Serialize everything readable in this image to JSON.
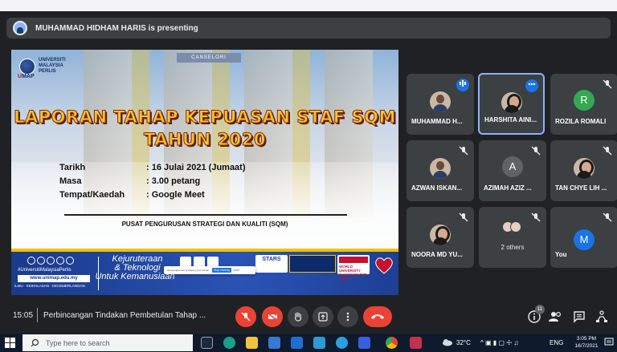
{
  "presenting": {
    "text": "MUHAMMAD HIDHAM HARIS is presenting"
  },
  "slide": {
    "logo_line1": "UNIVERSITI",
    "logo_line2": "MALAYSIA",
    "logo_line3": "PERLIS",
    "logo_abbr_prefix": "U",
    "logo_abbr": "MAP",
    "sign": "CANSELORI",
    "title_line1": "LAPORAN TAHAP KEPUASAN STAF SQM",
    "title_line2": "TAHUN 2020",
    "details": [
      {
        "key": "Tarikh",
        "value": ": 16 Julai 2021 (Jumaat)"
      },
      {
        "key": "Masa",
        "value": ": 3.00 petang"
      },
      {
        "key": "Tempat/Kaedah",
        "value": ": Google Meet"
      }
    ],
    "organizer": "PUSAT PENGURUSAN STRATEGI DAN KUALITI (SQM)",
    "footer": {
      "hashtag": "#UniversitiMalaysiaPerlis",
      "website": "www.unimap.edu.my",
      "motto": "ILMU · KEIKHLASAN · KECEMERLANGAN",
      "tag_line1": "Kejuruteraan",
      "tag_line2": "& Teknologi",
      "tag_line3": "Untuk Kemanusiaan",
      "popup_text": "meet.google.com is sharing your screen.",
      "popup_stop": "Stop sharing",
      "popup_hide": "Hide",
      "stars_label": "STARS",
      "world_label": "WORLD UNIVERSITY RANKINGS",
      "world_sub": "TOP 1000+"
    }
  },
  "participants": [
    {
      "name": "MUHAMMAD H...",
      "type": "photo",
      "status": "speaking"
    },
    {
      "name": "HARSHITA AINI...",
      "type": "photo-hijab",
      "status": "more",
      "active": true
    },
    {
      "name": "ROZILA ROMALI",
      "type": "letter",
      "letter": "R",
      "color": "#34a853",
      "status": "muted"
    },
    {
      "name": "AZWAN ISKAN...",
      "type": "photo",
      "status": "muted"
    },
    {
      "name": "AZIMAH AZIZ ...",
      "type": "letter",
      "letter": "A",
      "color": "#5f6368",
      "status": "muted"
    },
    {
      "name": "TAN CHYE LIH ...",
      "type": "photo-hijab",
      "status": "muted"
    },
    {
      "name": "NOORA MD YU...",
      "type": "photo-hijab",
      "status": "muted"
    },
    {
      "name": "2 others",
      "type": "group",
      "status": "muted"
    },
    {
      "name": "You",
      "type": "letter",
      "letter": "M",
      "color": "#1a73e8",
      "status": "muted"
    }
  ],
  "controls": {
    "time": "15:05",
    "meeting_title": "Perbincangan Tindakan Pembetulan Tahap ...",
    "people_count": "11"
  },
  "taskbar": {
    "search_placeholder": "Type here to search",
    "temperature": "32°C",
    "language": "ENG",
    "time": "3:05 PM",
    "date": "16/7/2021"
  },
  "colors": {
    "meet_bg": "#202124",
    "tile_bg": "#3c4043",
    "end_call": "#ea4335",
    "accent": "#8ab4f8"
  }
}
